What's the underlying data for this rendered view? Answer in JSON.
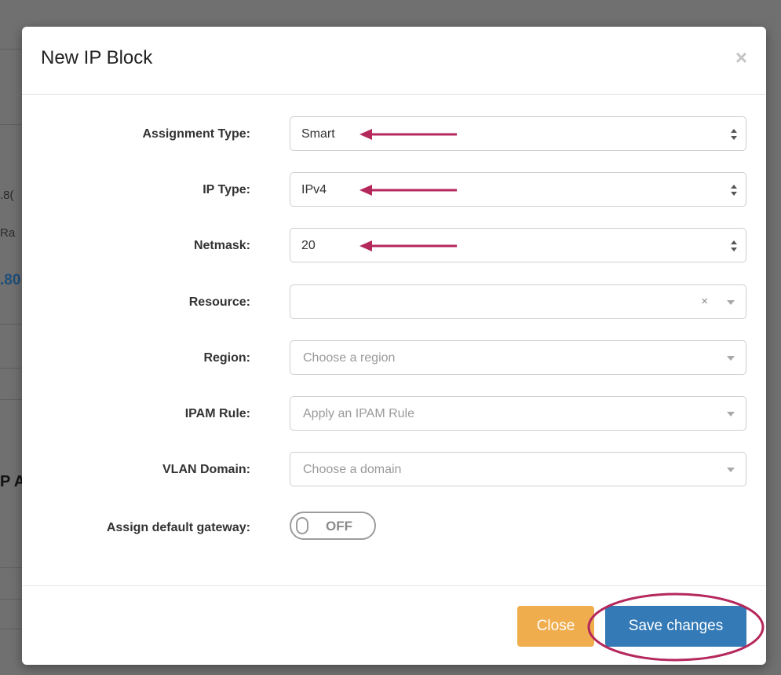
{
  "background": {
    "fragments": [
      ".8(",
      "Ra",
      ".80",
      "P A"
    ]
  },
  "modal": {
    "title": "New IP Block",
    "close_glyph": "×"
  },
  "form": {
    "assignment_type": {
      "label": "Assignment Type:",
      "value": "Smart"
    },
    "ip_type": {
      "label": "IP Type:",
      "value": "IPv4"
    },
    "netmask": {
      "label": "Netmask:",
      "value": "20"
    },
    "resource": {
      "label": "Resource:",
      "value": "",
      "clear_glyph": "×"
    },
    "region": {
      "label": "Region:",
      "placeholder": "Choose a region"
    },
    "ipam_rule": {
      "label": "IPAM Rule:",
      "placeholder": "Apply an IPAM Rule"
    },
    "vlan_domain": {
      "label": "VLAN Domain:",
      "placeholder": "Choose a domain"
    },
    "default_gateway": {
      "label": "Assign default gateway:",
      "state": "OFF"
    }
  },
  "footer": {
    "close_label": "Close",
    "save_label": "Save changes"
  },
  "colors": {
    "annotation": "#b5285c",
    "primary": "#337ab7",
    "warning": "#f0ad4e"
  },
  "icons": {
    "select_arrows": "updown-icon",
    "dropdown": "chevron-down-icon",
    "annotation": "arrow-left-icon"
  }
}
